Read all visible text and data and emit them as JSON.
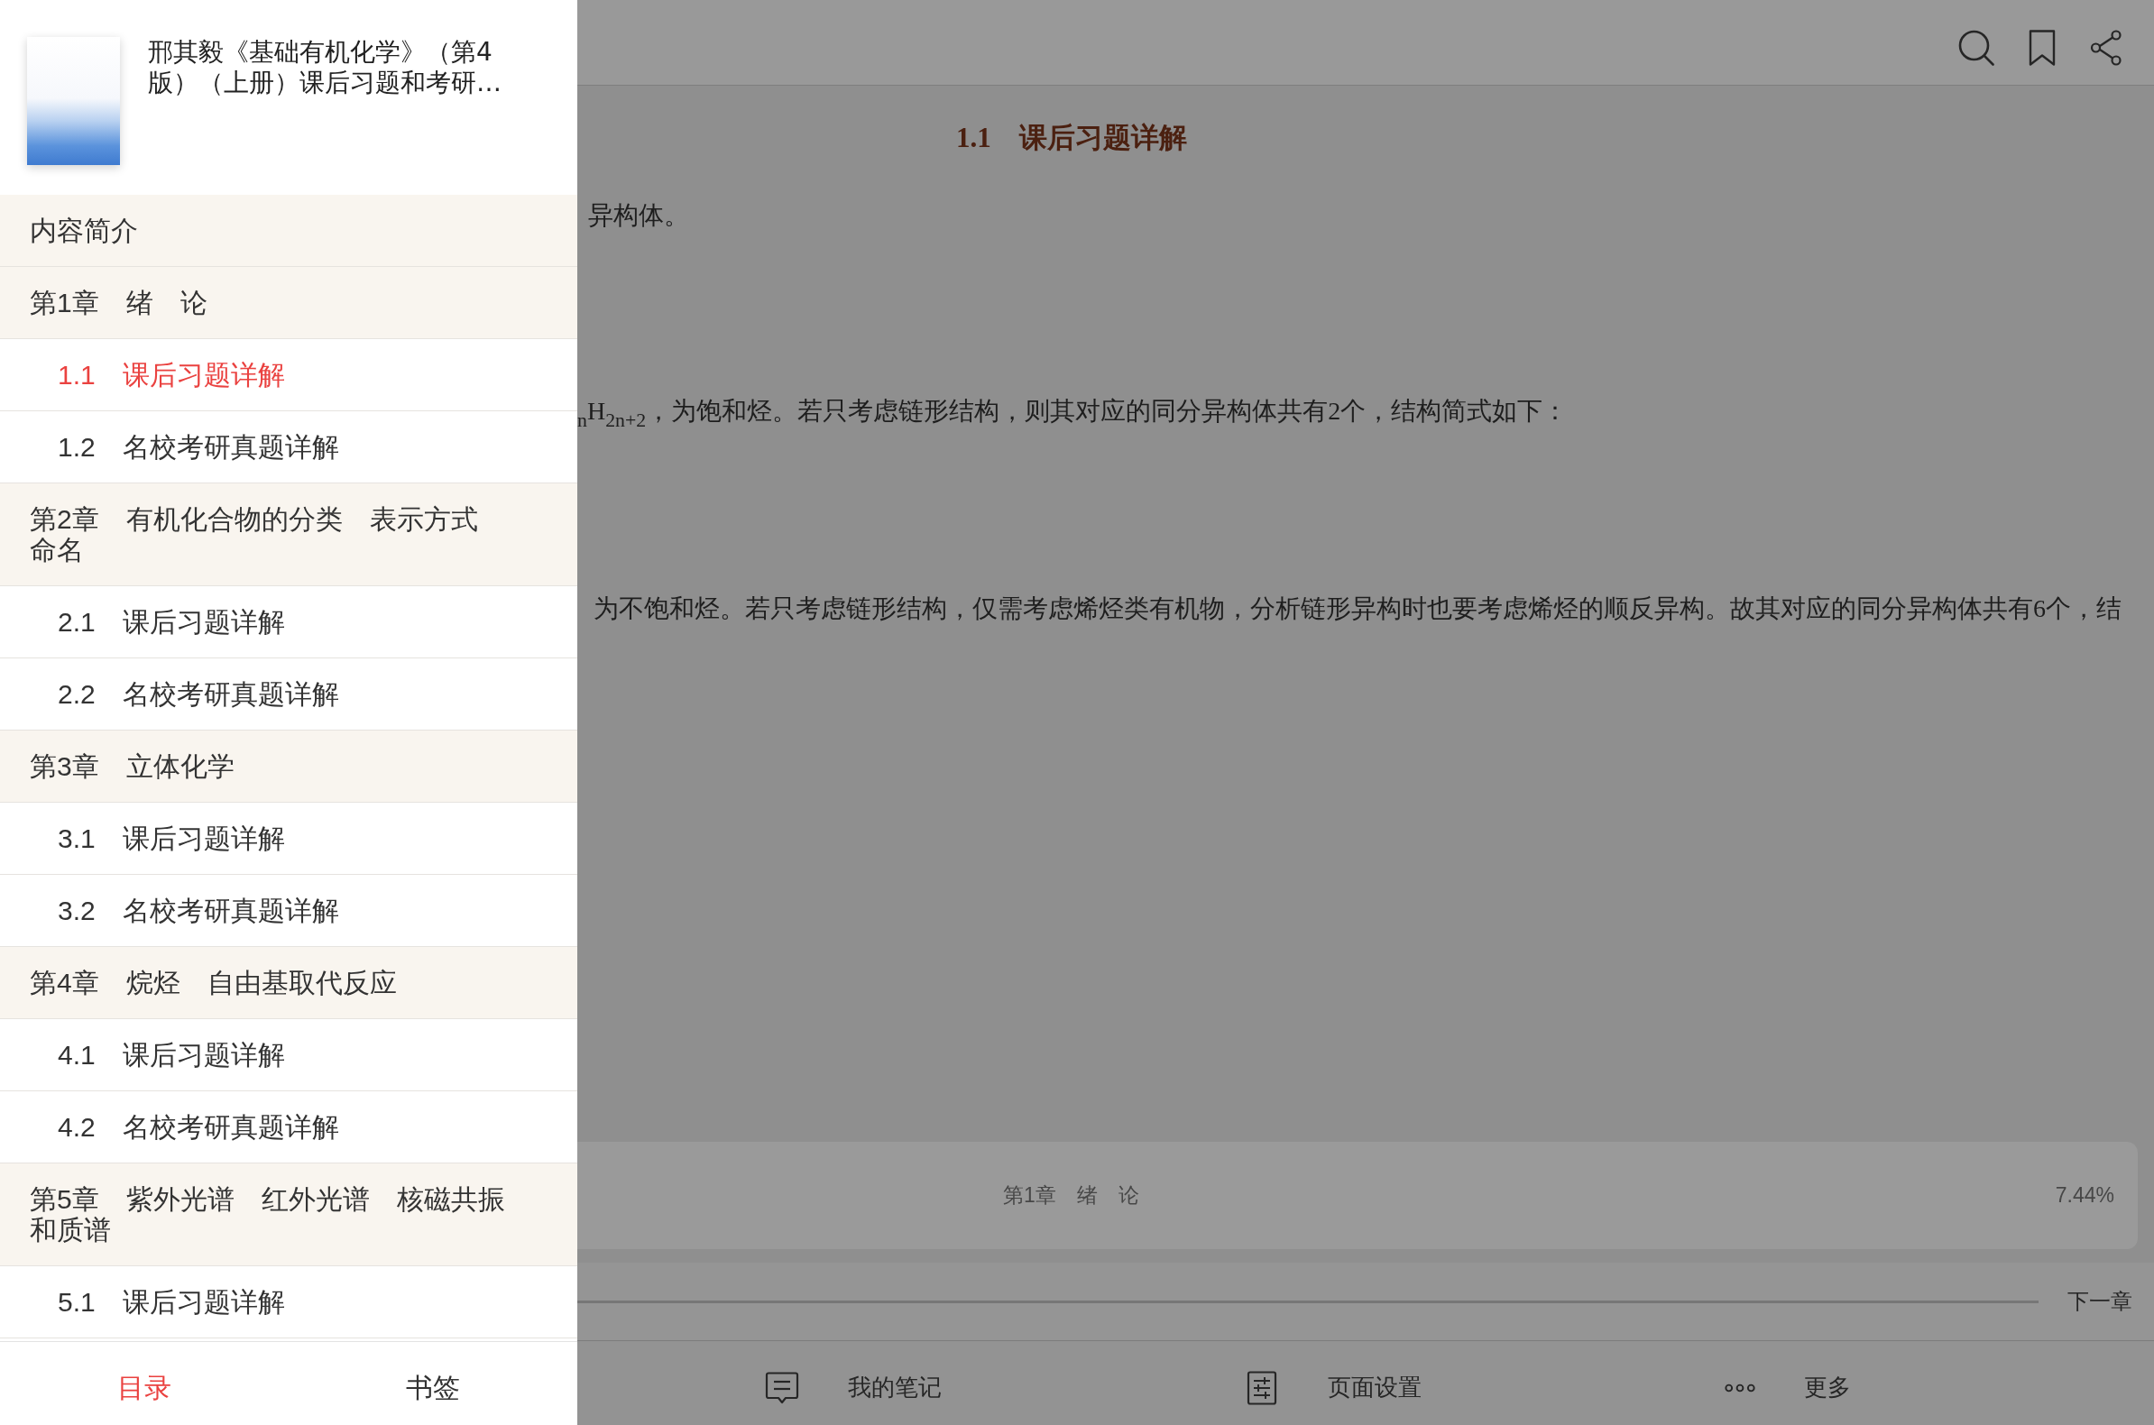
{
  "book": {
    "title": "邢其毅《基础有机化学》（第4版）（上册）课后习题和考研…"
  },
  "toc": [
    {
      "label": "内容简介",
      "selected": false
    },
    {
      "label": "第1章　绪　论",
      "selected": false,
      "children": [
        {
          "label": "1.1　课后习题详解",
          "selected": true
        },
        {
          "label": "1.2　名校考研真题详解",
          "selected": false
        }
      ]
    },
    {
      "label": "第2章　有机化合物的分类　表示方式命名",
      "selected": false,
      "children": [
        {
          "label": "2.1　课后习题详解",
          "selected": false
        },
        {
          "label": "2.2　名校考研真题详解",
          "selected": false
        }
      ]
    },
    {
      "label": "第3章　立体化学",
      "selected": false,
      "children": [
        {
          "label": "3.1　课后习题详解",
          "selected": false
        },
        {
          "label": "3.2　名校考研真题详解",
          "selected": false
        }
      ]
    },
    {
      "label": "第4章　烷烃　自由基取代反应",
      "selected": false,
      "children": [
        {
          "label": "4.1　课后习题详解",
          "selected": false
        },
        {
          "label": "4.2　名校考研真题详解",
          "selected": false
        }
      ]
    },
    {
      "label": "第5章　紫外光谱　红外光谱　核磁共振和质谱",
      "selected": false,
      "children": [
        {
          "label": "5.1　课后习题详解",
          "selected": false
        }
      ]
    }
  ],
  "sidebar_tabs": [
    {
      "label": "目录",
      "selected": true
    },
    {
      "label": "书签",
      "selected": false
    }
  ],
  "reader": {
    "heading": "1.1　课后习题详解",
    "paragraphs": [
      "异构体。",
      "$_{n}$H$_{2n+2}$，为饱和烃。若只考虑链形结构，则其对应的同分异构体共有2个，结构简式如下：",
      "为不饱和烃。若只考虑链形结构，仅需考虑烯烃类有机物，分析链形异构时也要考虑烯烃的顺反异构。故其对应的同分异构体共有6个，结"
    ]
  },
  "progress_card": {
    "chapter": "第1章　绪　论",
    "percent": "7.44%"
  },
  "chapter_nav": {
    "next": "下一章"
  },
  "bottom_toolbar": [
    {
      "kind": "notes",
      "label": "我的笔记"
    },
    {
      "kind": "page_settings",
      "label": "页面设置"
    },
    {
      "kind": "more",
      "label": "更多"
    }
  ]
}
